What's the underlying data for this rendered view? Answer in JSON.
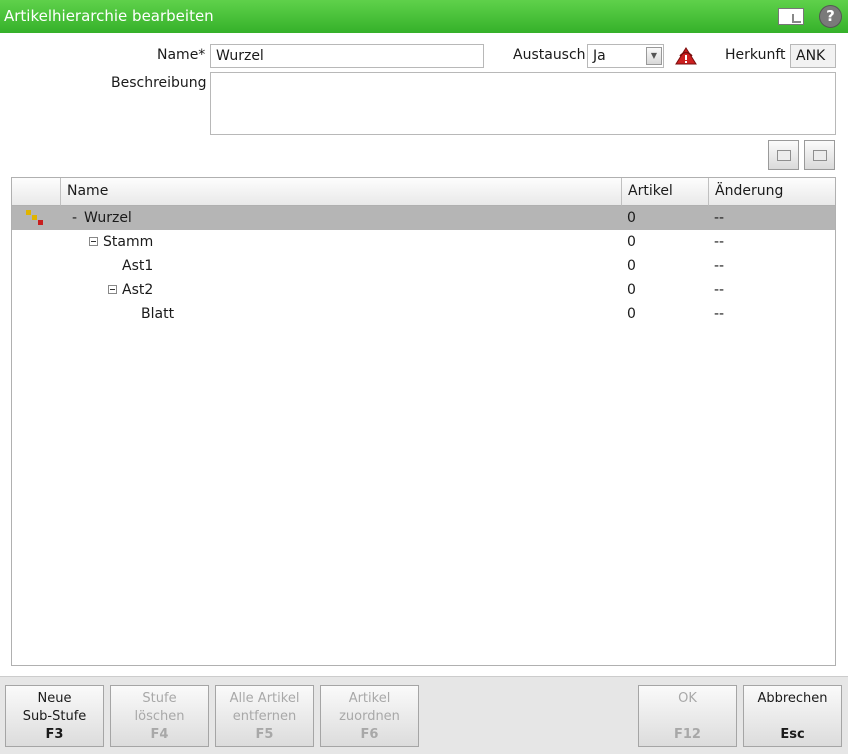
{
  "window": {
    "title": "Artikelhierarchie bearbeiten",
    "doc_icon": "document-export-icon",
    "help_icon": "help-icon",
    "help_glyph": "?"
  },
  "form": {
    "name_label": "Name*",
    "name_value": "Wurzel",
    "austausch_label": "Austausch",
    "austausch_value": "Ja",
    "austausch_arrow": "▼",
    "herkunft_label": "Herkunft",
    "herkunft_value": "ANK",
    "beschreibung_label": "Beschreibung",
    "beschreibung_value": ""
  },
  "grid": {
    "columns": [
      "Name",
      "Artikel",
      "Änderung"
    ],
    "rows": [
      {
        "name": "Wurzel",
        "prefix": "-",
        "artikel": "0",
        "aenderung": "--",
        "selected": true
      },
      {
        "name": "Stamm",
        "artikel": "0",
        "aenderung": "--"
      },
      {
        "name": "Ast1",
        "artikel": "0",
        "aenderung": "--"
      },
      {
        "name": "Ast2",
        "artikel": "0",
        "aenderung": "--"
      },
      {
        "name": "Blatt",
        "artikel": "0",
        "aenderung": "--"
      }
    ]
  },
  "buttons": {
    "neue_line1": "Neue",
    "neue_line2": "Sub-Stufe",
    "neue_key": "F3",
    "stufe_line1": "Stufe",
    "stufe_line2": "löschen",
    "stufe_key": "F4",
    "alle_line1": "Alle Artikel",
    "alle_line2": "entfernen",
    "alle_key": "F5",
    "zuordnen_line1": "Artikel",
    "zuordnen_line2": "zuordnen",
    "zuordnen_key": "F6",
    "ok_label": "OK",
    "ok_key": "F12",
    "abbrechen_label": "Abbrechen",
    "abbrechen_key": "Esc"
  },
  "colors": {
    "titlebar": "#35b12a",
    "selected_row": "#b5b5b5",
    "alert_icon": "#cc1f1f"
  }
}
